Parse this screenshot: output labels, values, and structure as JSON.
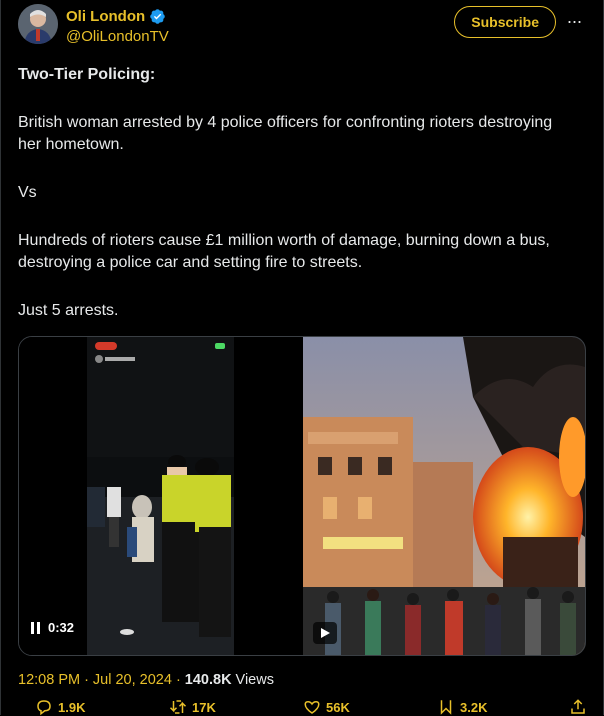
{
  "author": {
    "name": "Oli London",
    "handle": "@OliLondonTV"
  },
  "subscribe_label": "Subscribe",
  "more_label": "···",
  "post": {
    "paragraphs": [
      "Two-Tier Policing:",
      "British woman arrested by 4 police officers for confronting rioters destroying her hometown.",
      "Vs",
      "Hundreds of rioters cause £1 million worth of damage, burning down a bus, destroying a police car and setting fire to streets.",
      "Just 5 arrests."
    ]
  },
  "media": {
    "left_video_time": "0:32"
  },
  "meta": {
    "time": "12:08 PM",
    "separator": "·",
    "date": "Jul 20, 2024",
    "views_count": "140.8K",
    "views_label": "Views"
  },
  "actions": {
    "replies": "1.9K",
    "reposts": "17K",
    "likes": "56K",
    "bookmarks": "3.2K"
  },
  "colors": {
    "accent": "#e8c02a",
    "verified": "#1d9bf0",
    "background": "#000000",
    "text": "#e7e9ea"
  }
}
